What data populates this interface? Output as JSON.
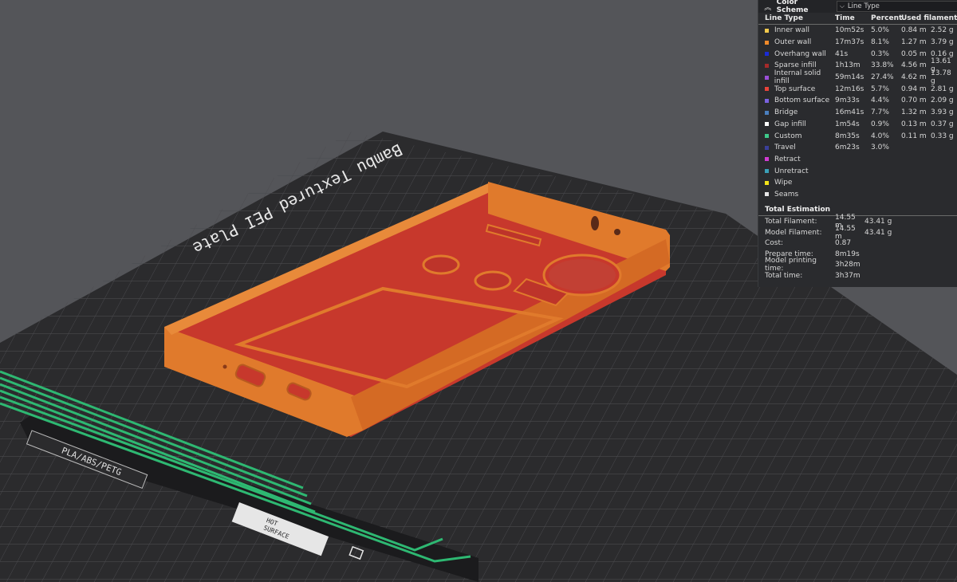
{
  "plate": {
    "title": "Bambu Textured PEI Plate",
    "material_label": "PLA/ABS/PETG",
    "hot_surface_line1": "HOT",
    "hot_surface_line2": "SURFACE"
  },
  "colors": {
    "background": "#545559",
    "plate": "#2c2c2e",
    "grid": "#4a4a4d",
    "model_orange": "#e07a2c",
    "model_red": "#c7382c",
    "stripe_green": "#2eb872"
  },
  "panel": {
    "collapse_icon": "double-chevron-up-icon",
    "title": "Color Scheme",
    "selected": "Line Type",
    "headers": {
      "type": "Line Type",
      "time": "Time",
      "percent": "Percent",
      "used": "Used filament"
    },
    "rows": [
      {
        "name": "Inner wall",
        "time": "10m52s",
        "percent": "5.0%",
        "length": "0.84 m",
        "weight": "2.52 g",
        "color": "#f2c94c"
      },
      {
        "name": "Outer wall",
        "time": "17m37s",
        "percent": "8.1%",
        "length": "1.27 m",
        "weight": "3.79 g",
        "color": "#f08a2a"
      },
      {
        "name": "Overhang wall",
        "time": "41s",
        "percent": "0.3%",
        "length": "0.05 m",
        "weight": "0.16 g",
        "color": "#1a2bd6"
      },
      {
        "name": "Sparse infill",
        "time": "1h13m",
        "percent": "33.8%",
        "length": "4.56 m",
        "weight": "13.61 g",
        "color": "#a52a2a"
      },
      {
        "name": "Internal solid infill",
        "time": "59m14s",
        "percent": "27.4%",
        "length": "4.62 m",
        "weight": "13.78 g",
        "color": "#9b4fd8"
      },
      {
        "name": "Top surface",
        "time": "12m16s",
        "percent": "5.7%",
        "length": "0.94 m",
        "weight": "2.81 g",
        "color": "#e8433a"
      },
      {
        "name": "Bottom surface",
        "time": "9m33s",
        "percent": "4.4%",
        "length": "0.70 m",
        "weight": "2.09 g",
        "color": "#7a62e0"
      },
      {
        "name": "Bridge",
        "time": "16m41s",
        "percent": "7.7%",
        "length": "1.32 m",
        "weight": "3.93 g",
        "color": "#4a7fbf"
      },
      {
        "name": "Gap infill",
        "time": "1m54s",
        "percent": "0.9%",
        "length": "0.13 m",
        "weight": "0.37 g",
        "color": "#ffffff"
      },
      {
        "name": "Custom",
        "time": "8m35s",
        "percent": "4.0%",
        "length": "0.11 m",
        "weight": "0.33 g",
        "color": "#3ec98a"
      },
      {
        "name": "Travel",
        "time": "6m23s",
        "percent": "3.0%",
        "length": "",
        "weight": "",
        "color": "#3a3f9a"
      },
      {
        "name": "Retract",
        "time": "",
        "percent": "",
        "length": "",
        "weight": "",
        "color": "#d23bd2"
      },
      {
        "name": "Unretract",
        "time": "",
        "percent": "",
        "length": "",
        "weight": "",
        "color": "#3aa0b8"
      },
      {
        "name": "Wipe",
        "time": "",
        "percent": "",
        "length": "",
        "weight": "",
        "color": "#f2e21a"
      },
      {
        "name": "Seams",
        "time": "",
        "percent": "",
        "length": "",
        "weight": "",
        "color": "#e6e6e6"
      }
    ],
    "estimation": {
      "title": "Total Estimation",
      "rows": [
        {
          "label": "Total Filament:",
          "v1": "14.55 m",
          "v2": "43.41 g"
        },
        {
          "label": "Model Filament:",
          "v1": "14.55 m",
          "v2": "43.41 g"
        },
        {
          "label": "Cost:",
          "v1": "0.87",
          "v2": ""
        },
        {
          "label": "Prepare time:",
          "v1": "8m19s",
          "v2": ""
        },
        {
          "label": "Model printing time:",
          "v1": "3h28m",
          "v2": ""
        },
        {
          "label": "Total time:",
          "v1": "3h37m",
          "v2": ""
        }
      ]
    }
  }
}
